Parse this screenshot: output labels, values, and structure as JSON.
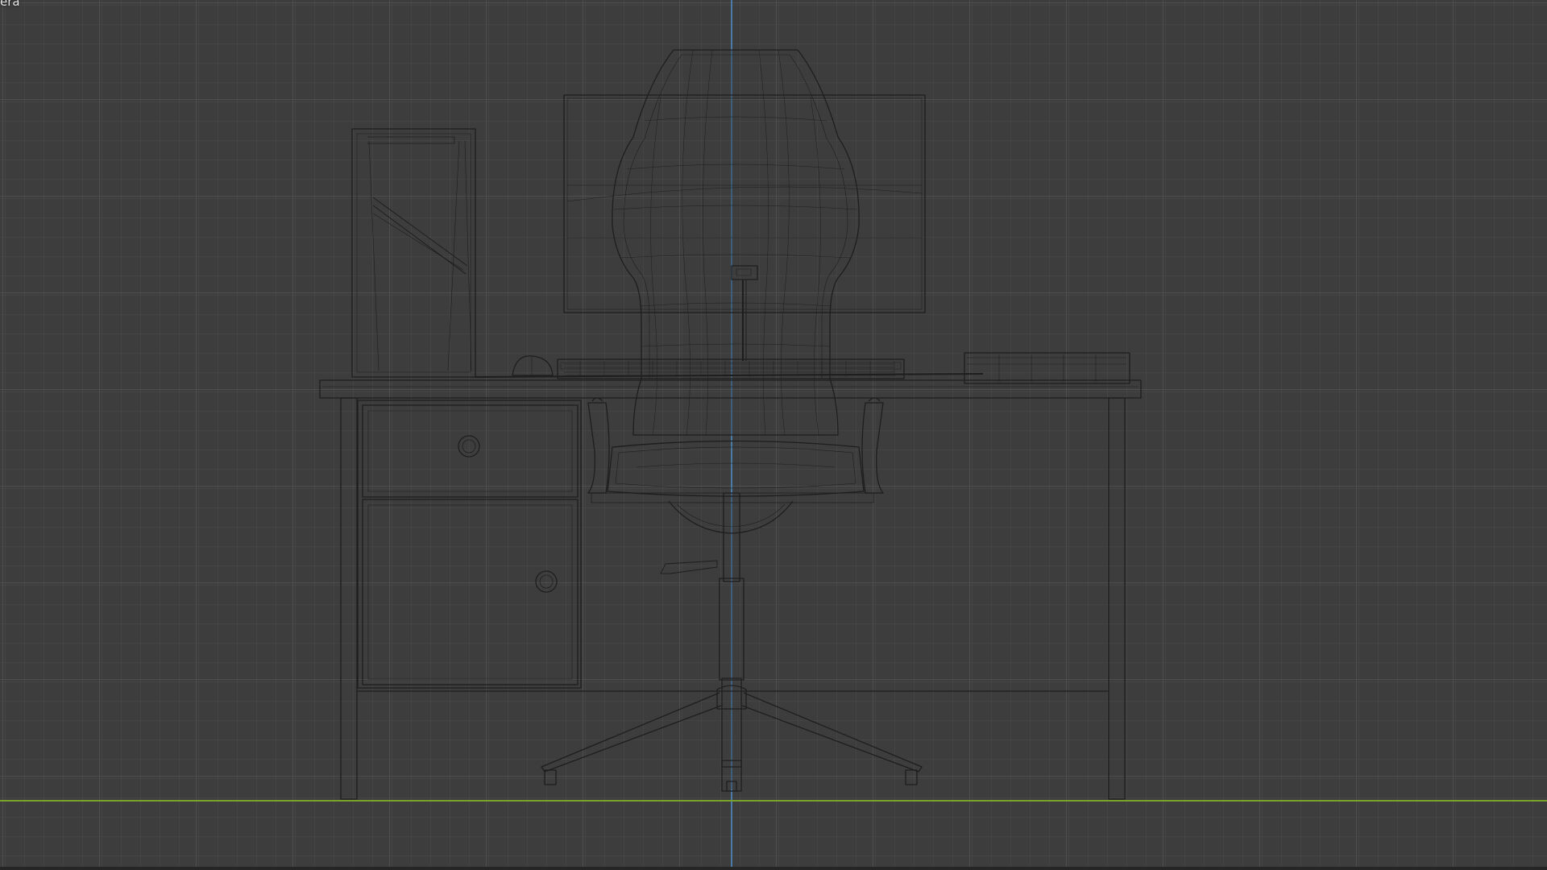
{
  "viewport": {
    "label": "era",
    "background_color": "#3d3d3d",
    "grid_minor_color": "#4b4b4b",
    "grid_major_color": "#555555",
    "vertical_axis_color": "#4f8fc9",
    "ground_axis_color": "#7aa22c",
    "wire_color": "#1e1e1e"
  },
  "scene": {
    "objects": [
      "computer-tower",
      "monitor",
      "office-chair",
      "desk",
      "keyboard",
      "mouse",
      "tray"
    ]
  }
}
